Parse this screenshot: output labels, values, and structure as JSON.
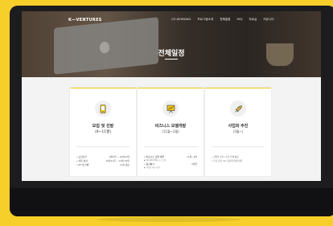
{
  "brand": {
    "logo": "K—VENTURES"
  },
  "menu": [
    "CO-WORKING",
    "프로그램소개",
    "전체일정",
    "FAQ",
    "자료실",
    "커뮤니티"
  ],
  "hero": {
    "title": "전체일정"
  },
  "cards": [
    {
      "title": "모집 및 선발",
      "period": "(9~11월)",
      "rows": [
        {
          "label": "• 모집기간",
          "value": "9월4일 ~ 10월10일"
        },
        {
          "label": "• 서류 심사",
          "value": "10월11일 ~ 10월 20일"
        },
        {
          "label": "• PT 및 선발",
          "value": "11월 중순"
        }
      ]
    },
    {
      "title": "비즈니스 모델개발",
      "period": "(11월~2월)",
      "rows": [
        {
          "label": "• 비즈니스 모델 개발",
          "value": "11월~2월",
          "sub": "▶ INCUBATING 프로그램"
        },
        {
          "label": "• 중간평가",
          "value": "2월말",
          "sub": "▶ 사업화 자금 지원"
        }
      ]
    },
    {
      "title": "사업화 추진",
      "period": "(3월~)",
      "notes": [
        "• 사업화 추진 / 투자 연계 활동",
        "• 투자 기관, VC, 대기업 연계 지원"
      ]
    }
  ],
  "colors": {
    "accent": "#f3c919",
    "background": "#f6cf2a"
  }
}
